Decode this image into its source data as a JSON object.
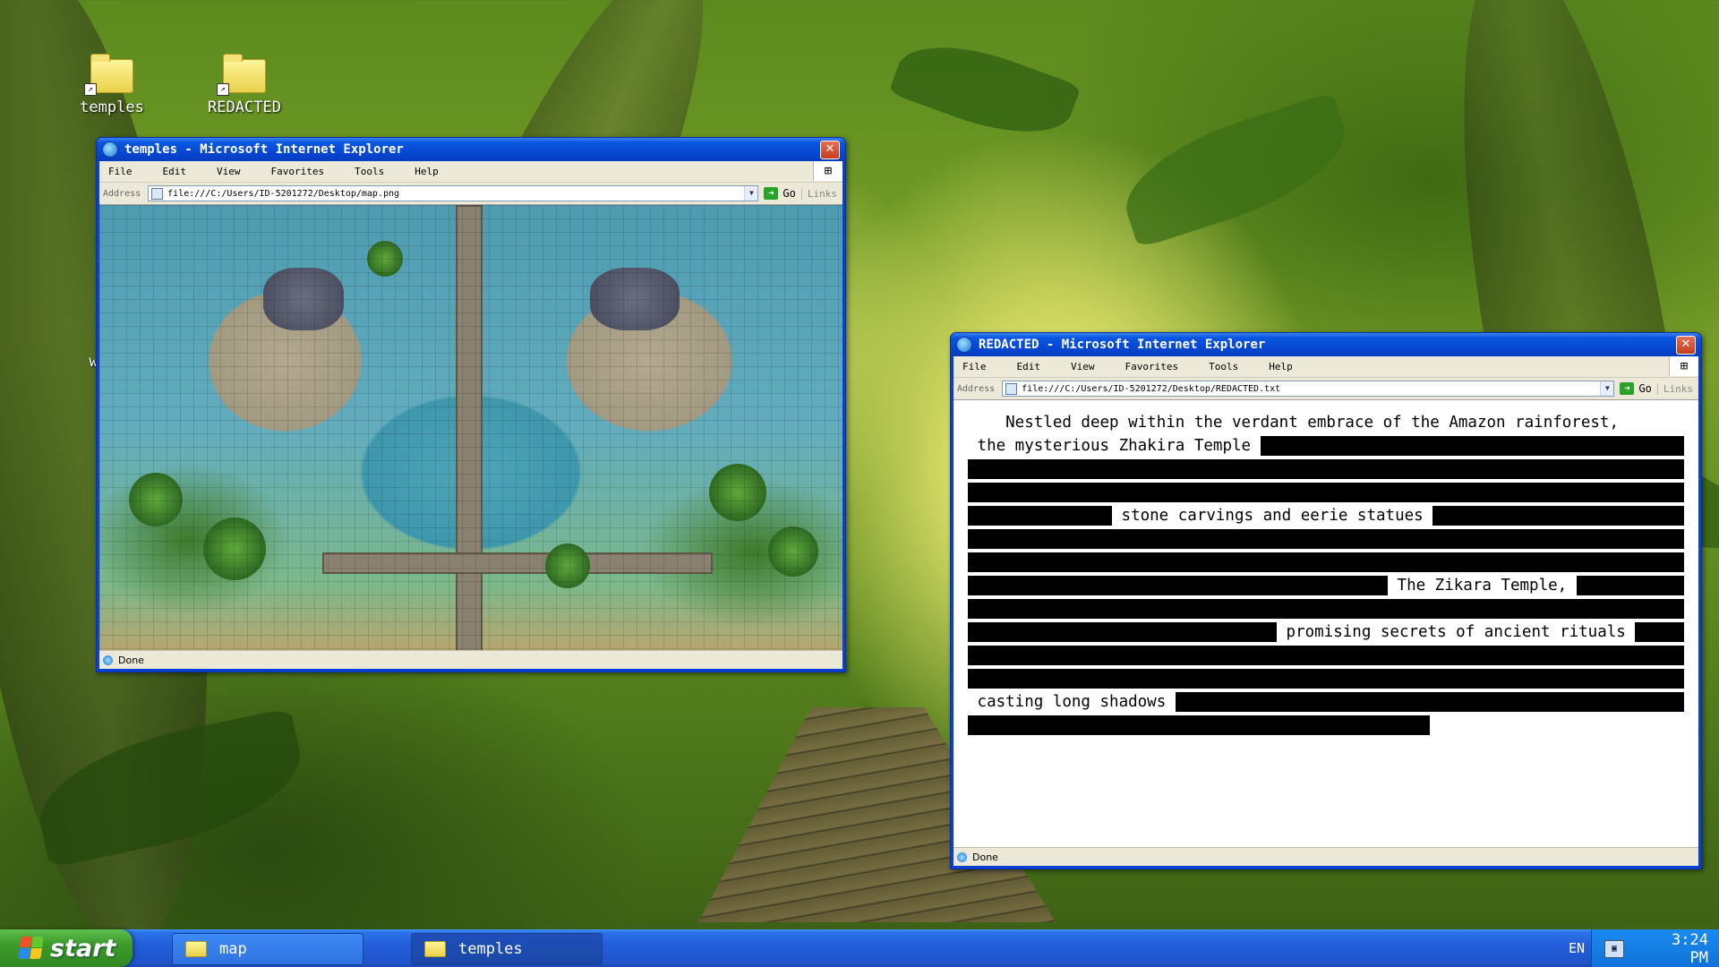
{
  "desktop": {
    "icons": [
      {
        "label": "temples",
        "icon": "folder-icon"
      },
      {
        "label": "REDACTED",
        "icon": "folder-icon"
      },
      {
        "label": "wi",
        "icon": "folder-icon"
      }
    ]
  },
  "window_map": {
    "title": "temples - Microsoft Internet Explorer",
    "menu": [
      "File",
      "Edit",
      "View",
      "Favorites",
      "Tools",
      "Help"
    ],
    "address_label": "Address",
    "address": "file:///C:/Users/ID-5201272/Desktop/map.png",
    "go_label": "Go",
    "links_label": "Links",
    "status": "Done"
  },
  "window_doc": {
    "title": "REDACTED - Microsoft Internet Explorer",
    "menu": [
      "File",
      "Edit",
      "View",
      "Favorites",
      "Tools",
      "Help"
    ],
    "address_label": "Address",
    "address": "file:///C:/Users/ID-5201272/Desktop/REDACTED.txt",
    "go_label": "Go",
    "links_label": "Links",
    "status": "Done",
    "text": {
      "l1": "    Nestled deep within the verdant embrace of the Amazon rainforest,",
      "l2": " the mysterious Zhakira Temple ",
      "l5": " stone carvings and eerie statues ",
      "l8": " The Zikara Temple, ",
      "l10": " promising secrets of ancient rituals ",
      "l13": " casting long shadows "
    }
  },
  "taskbar": {
    "start_label": "start",
    "tasks": [
      "map",
      "temples"
    ],
    "language": "EN",
    "clock_time": "3:24",
    "clock_period": "PM"
  },
  "colors": {
    "xp_blue": "#0a3fd6",
    "start_green": "#3c9a2a",
    "redaction": "#000000"
  }
}
